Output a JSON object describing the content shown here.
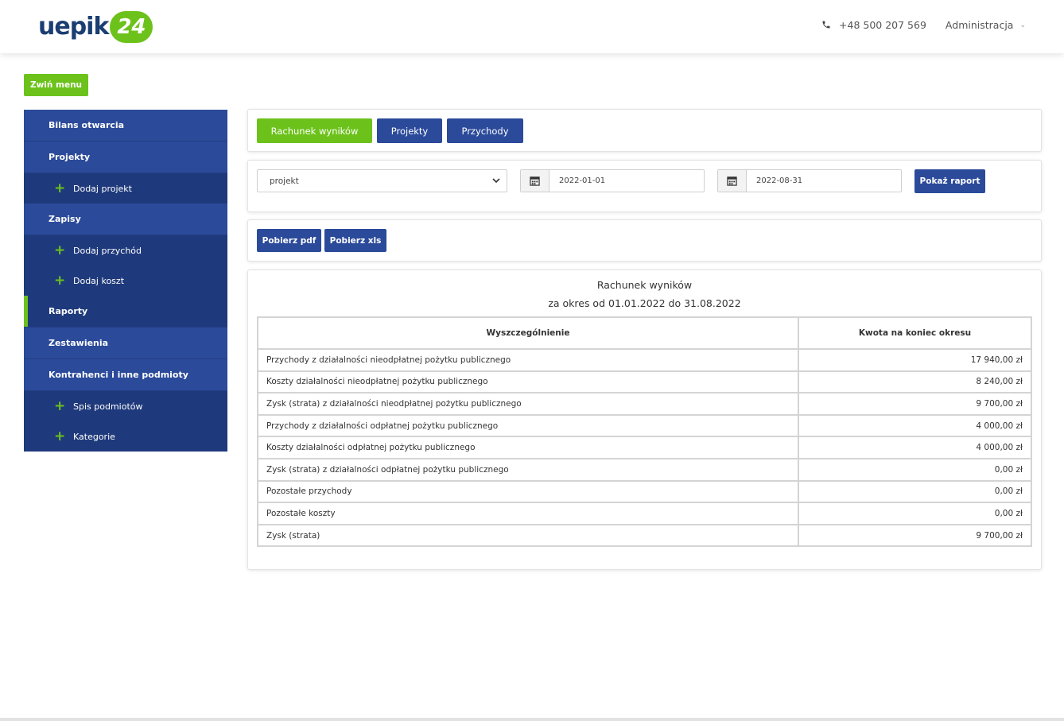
{
  "header": {
    "logo_text": "uepik",
    "logo_badge": "24",
    "phone": "+48 500 207 569",
    "admin_label": "Administracja",
    "phone_icon": "phone-icon",
    "chevron_icon": "chevron-down-icon"
  },
  "collapse_label": "Zwiń menu",
  "sidebar": {
    "items": [
      {
        "label": "Bilans otwarcia"
      },
      {
        "label": "Projekty"
      },
      {
        "label": "Dodaj projekt"
      },
      {
        "label": "Zapisy"
      },
      {
        "label": "Dodaj przychód"
      },
      {
        "label": "Dodaj koszt"
      },
      {
        "label": "Raporty"
      },
      {
        "label": "Zestawienia"
      },
      {
        "label": "Kontrahenci i inne podmioty"
      },
      {
        "label": "Spis podmiotów"
      },
      {
        "label": "Kategorie"
      }
    ],
    "plus_icon": "+"
  },
  "tabs": {
    "rachunek": "Rachunek wyników",
    "projekty": "Projekty",
    "przychody": "Przychody"
  },
  "filters": {
    "select_value": "projekt",
    "date_from": "2022-01-01",
    "date_to": "2022-08-31",
    "show_report": "Pokaż raport"
  },
  "downloads": {
    "pdf": "Pobierz pdf",
    "xls": "Pobierz xls"
  },
  "report": {
    "title": "Rachunek wyników",
    "subtitle": "za okres od 01.01.2022 do 31.08.2022",
    "columns": [
      "Wyszczególnienie",
      "Kwota na koniec okresu"
    ],
    "rows": [
      {
        "label": "Przychody z działalności nieodpłatnej pożytku publicznego",
        "amount": "17 940,00 zł"
      },
      {
        "label": "Koszty działalności nieodpłatnej pożytku publicznego",
        "amount": "8 240,00 zł"
      },
      {
        "label": "Zysk (strata) z działalności nieodpłatnej pożytku publicznego",
        "amount": "9 700,00 zł"
      },
      {
        "label": "Przychody z działalności odpłatnej pożytku publicznego",
        "amount": "4 000,00 zł"
      },
      {
        "label": "Koszty działalności odpłatnej pożytku publicznego",
        "amount": "4 000,00 zł"
      },
      {
        "label": "Zysk (strata) z działalności odpłatnej pożytku publicznego",
        "amount": "0,00 zł"
      },
      {
        "label": "Pozostałe przychody",
        "amount": "0,00 zł"
      },
      {
        "label": "Pozostałe koszty",
        "amount": "0,00 zł"
      },
      {
        "label": "Zysk (strata)",
        "amount": "9 700,00 zł"
      }
    ]
  },
  "colors": {
    "brand_green": "#6cc21b",
    "brand_blue": "#2b4a9a",
    "sidebar_sub": "#1f3a7c",
    "logo_navy": "#1b3e72"
  }
}
